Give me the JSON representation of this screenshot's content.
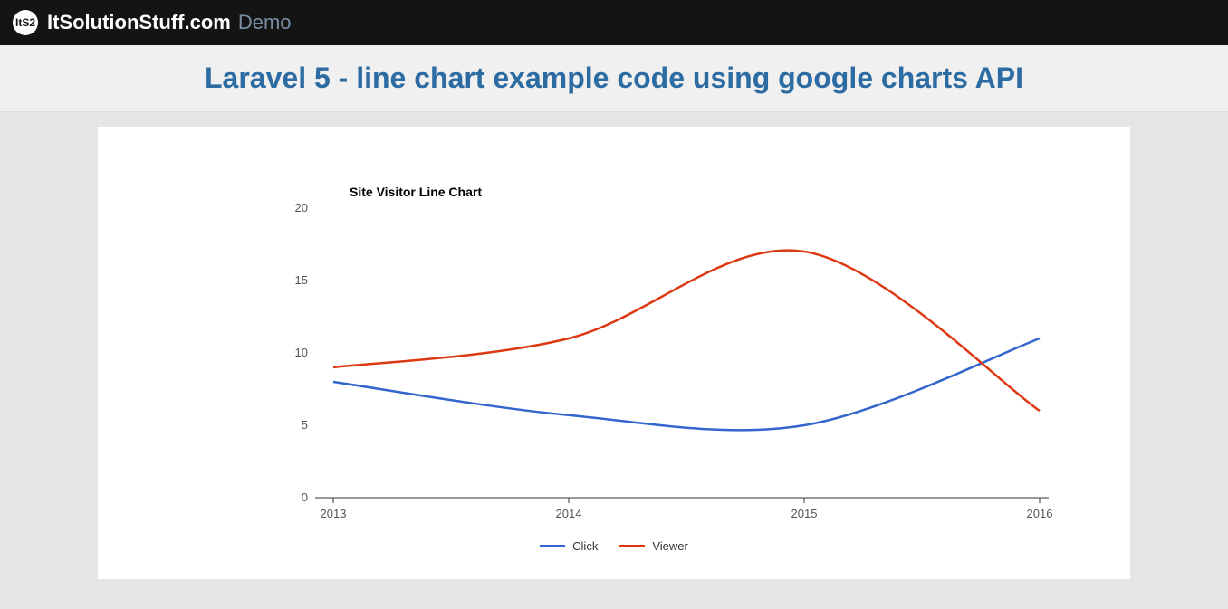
{
  "header": {
    "logo_text": "ItS2",
    "brand": "ItSolutionStuff.com",
    "demo_label": "Demo"
  },
  "page_title": "Laravel 5 - line chart example code using google charts API",
  "chart_data": {
    "type": "line",
    "title": "Site Visitor Line Chart",
    "x": [
      "2013",
      "2014",
      "2015",
      "2016"
    ],
    "series": [
      {
        "name": "Click",
        "color": "#3366cc",
        "values": [
          8,
          5.7,
          5,
          11
        ]
      },
      {
        "name": "Viewer",
        "color": "#dc3912",
        "values": [
          9,
          11,
          17,
          6
        ]
      }
    ],
    "y_ticks": [
      0,
      5,
      10,
      15,
      20
    ],
    "ylim": [
      0,
      20
    ],
    "legend": [
      "Click",
      "Viewer"
    ]
  }
}
